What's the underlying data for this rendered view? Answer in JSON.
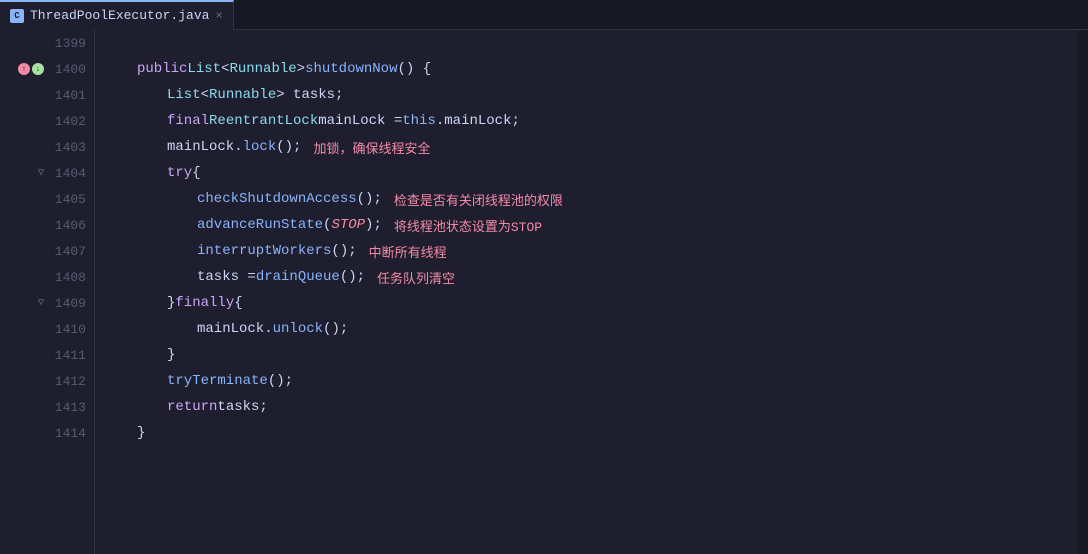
{
  "tab": {
    "label": "ThreadPoolExecutor.java",
    "icon": "C",
    "close": "×"
  },
  "lines": [
    {
      "num": "1399",
      "icons": [],
      "indent": 0,
      "tokens": []
    },
    {
      "num": "1400",
      "icons": [
        "up",
        "down"
      ],
      "indent": 2,
      "code_id": "1400"
    },
    {
      "num": "1401",
      "icons": [],
      "indent": 3,
      "code_id": "1401"
    },
    {
      "num": "1402",
      "icons": [],
      "indent": 3,
      "code_id": "1402"
    },
    {
      "num": "1403",
      "icons": [],
      "indent": 3,
      "code_id": "1403"
    },
    {
      "num": "1404",
      "icons": [],
      "indent": 3,
      "fold": true,
      "code_id": "1404"
    },
    {
      "num": "1405",
      "icons": [],
      "indent": 4,
      "code_id": "1405"
    },
    {
      "num": "1406",
      "icons": [],
      "indent": 4,
      "code_id": "1406"
    },
    {
      "num": "1407",
      "icons": [],
      "indent": 4,
      "code_id": "1407"
    },
    {
      "num": "1408",
      "icons": [],
      "indent": 4,
      "code_id": "1408"
    },
    {
      "num": "1409",
      "icons": [],
      "indent": 3,
      "fold": true,
      "code_id": "1409"
    },
    {
      "num": "1410",
      "icons": [],
      "indent": 4,
      "code_id": "1410"
    },
    {
      "num": "1411",
      "icons": [],
      "indent": 3,
      "code_id": "1411"
    },
    {
      "num": "1412",
      "icons": [],
      "indent": 3,
      "code_id": "1412"
    },
    {
      "num": "1413",
      "icons": [],
      "indent": 3,
      "code_id": "1413"
    },
    {
      "num": "1414",
      "icons": [],
      "indent": 2,
      "code_id": "1414"
    }
  ],
  "annotations": {
    "1403": "加锁，确保线程安全",
    "1405": "检查是否有关闭线程池的权限",
    "1406": "将线程池状态设置为STOP",
    "1407": "中断所有线程",
    "1408": "任务队列清空"
  }
}
